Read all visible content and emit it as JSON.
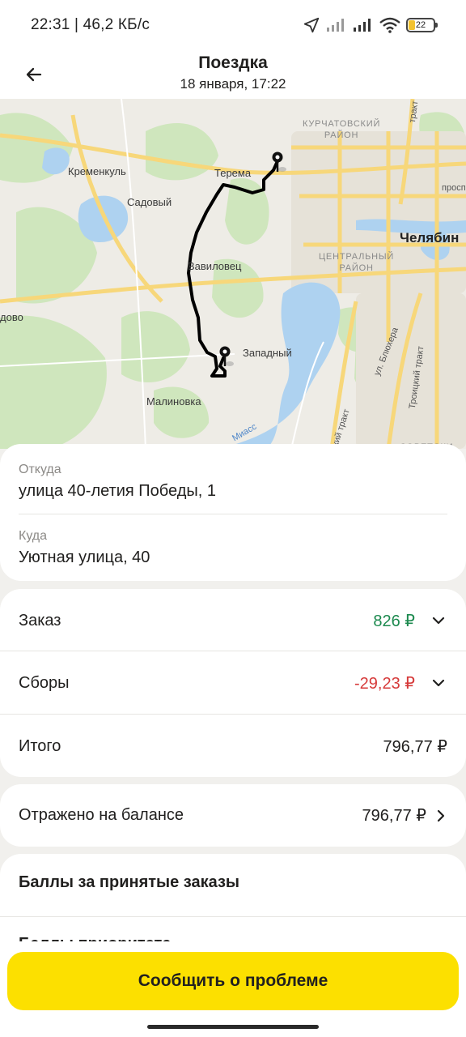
{
  "status_bar": {
    "time_speed": "22:31 | 46,2 КБ/с",
    "battery": "22",
    "icons": [
      "location-arrow-icon",
      "signal-icon",
      "signal-icon",
      "wifi-icon",
      "battery-icon"
    ]
  },
  "header": {
    "back_icon": "arrow-left-icon",
    "title": "Поездка",
    "subtitle": "18 января, 17:22"
  },
  "map": {
    "labels": {
      "kremenkul": "Кременкуль",
      "terema": "Терема",
      "sadovy": "Садовый",
      "vavilovets": "Вавиловец",
      "zapadny": "Западный",
      "malinovka": "Малиновка",
      "dovo": "дово",
      "chelyabinsk": "Челябин",
      "kurchatovsky_1": "КУРЧАТОВСКИЙ",
      "kurchatovsky_2": "РАЙОН",
      "central_1": "ЦЕНТРАЛЬНЫЙ",
      "central_2": "РАЙОН",
      "sovetsky": "СОВЕТСКИ",
      "blyukhera": "ул. Блюхера",
      "troitsky": "Троицкий тракт",
      "prosp": "просп",
      "trakt_top": "тракт",
      "miass": "Миасс",
      "trakt_bottom": "кий тракт"
    },
    "colors": {
      "route": "#000000",
      "water": "#aed2f0",
      "forest": "#cfe6bd",
      "road": "#f7d77a",
      "land": "#eeece6"
    }
  },
  "trip": {
    "from_caption": "Откуда",
    "from_value": "улица 40-летия Победы, 1",
    "to_caption": "Куда",
    "to_value": "Уютная улица, 40"
  },
  "payment": {
    "order_label": "Заказ",
    "order_value": "826 ₽",
    "fees_label": "Сборы",
    "fees_value": "-29,23 ₽",
    "total_label": "Итого",
    "total_value": "796,77 ₽"
  },
  "balance": {
    "label": "Отражено на балансе",
    "value": "796,77 ₽"
  },
  "points": {
    "title": "Баллы за принятые заказы",
    "priority": "Баллы приоритета"
  },
  "actions": {
    "report_problem": "Сообщить о проблеме"
  }
}
